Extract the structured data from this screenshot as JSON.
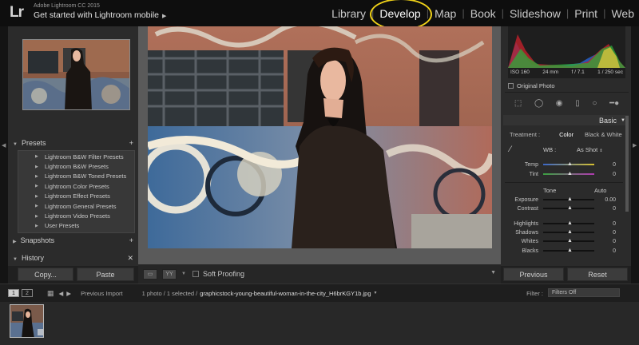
{
  "app": {
    "logo": "Lr",
    "name": "Adobe Lightroom CC 2015",
    "identity": "Get started with Lightroom mobile"
  },
  "modules": [
    "Library",
    "Develop",
    "Map",
    "Book",
    "Slideshow",
    "Print",
    "Web"
  ],
  "active_module": "Develop",
  "left_panel": {
    "presets_label": "Presets",
    "presets": [
      "Lightroom B&W Filter Presets",
      "Lightroom B&W Presets",
      "Lightroom B&W Toned Presets",
      "Lightroom Color Presets",
      "Lightroom Effect Presets",
      "Lightroom General Presets",
      "Lightroom Video Presets",
      "User Presets"
    ],
    "snapshots_label": "Snapshots",
    "history_label": "History",
    "copy_label": "Copy...",
    "paste_label": "Paste"
  },
  "toolbar": {
    "soft_proofing_label": "Soft Proofing"
  },
  "right_panel": {
    "exif": {
      "iso": "ISO 160",
      "focal": "24 mm",
      "aperture": "f / 7.1",
      "shutter": "1 / 250 sec"
    },
    "original_photo_label": "Original Photo",
    "basic_label": "Basic",
    "treatment_label": "Treatment :",
    "treatment_color": "Color",
    "treatment_bw": "Black & White",
    "wb_label": "WB :",
    "wb_value": "As Shot",
    "tone_label": "Tone",
    "auto_label": "Auto",
    "sliders": [
      {
        "label": "Temp",
        "value": "0"
      },
      {
        "label": "Tint",
        "value": "0"
      },
      {
        "label": "Exposure",
        "value": "0.00"
      },
      {
        "label": "Contrast",
        "value": "0"
      },
      {
        "label": "Highlights",
        "value": "0"
      },
      {
        "label": "Shadows",
        "value": "0"
      },
      {
        "label": "Whites",
        "value": "0"
      },
      {
        "label": "Blacks",
        "value": "0"
      }
    ],
    "previous_label": "Previous",
    "reset_label": "Reset"
  },
  "filmstrip": {
    "page1": "1",
    "page2": "2",
    "source": "Previous Import",
    "selection": "1 photo / 1 selected /",
    "filename": "graphicstock-young-beautiful-woman-in-the-city_H6brKGY1b.jpg",
    "filter_label": "Filter :",
    "filter_value": "Filters Off"
  },
  "colors": {
    "highlight_circle": "#f0d218",
    "panel_bg": "#2b2b2b",
    "center_bg": "#5a5a5a"
  }
}
